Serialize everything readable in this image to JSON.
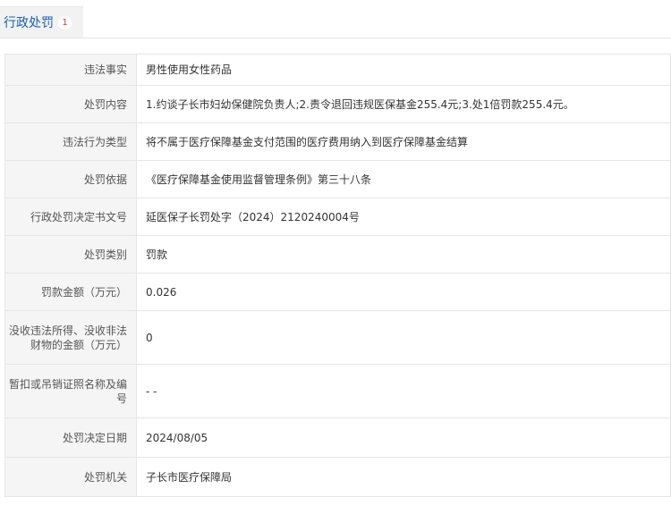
{
  "tab": {
    "label": "行政处罚",
    "count": "1"
  },
  "rows": [
    {
      "label": "违法事实",
      "value": "男性使用女性药品"
    },
    {
      "label": "处罚内容",
      "value": "1.约谈子长市妇幼保健院负责人;2.责令退回违规医保基金255.4元;3.处1倍罚款255.4元。"
    },
    {
      "label": "违法行为类型",
      "value": "将不属于医疗保障基金支付范围的医疗费用纳入到医疗保障基金结算"
    },
    {
      "label": "处罚依据",
      "value": "《医疗保障基金使用监督管理条例》第三十八条"
    },
    {
      "label": "行政处罚决定书文号",
      "value": "延医保子长罚处字（2024）2120240004号"
    },
    {
      "label": "处罚类别",
      "value": "罚款"
    },
    {
      "label": "罚款金额（万元）",
      "value": "0.026"
    },
    {
      "label": "没收违法所得、没收非法财物的金额（万元）",
      "value": "0"
    },
    {
      "label": "暂扣或吊销证照名称及编号",
      "value": "- -"
    },
    {
      "label": "处罚决定日期",
      "value": "2024/08/05"
    },
    {
      "label": "处罚机关",
      "value": "子长市医疗保障局"
    }
  ]
}
